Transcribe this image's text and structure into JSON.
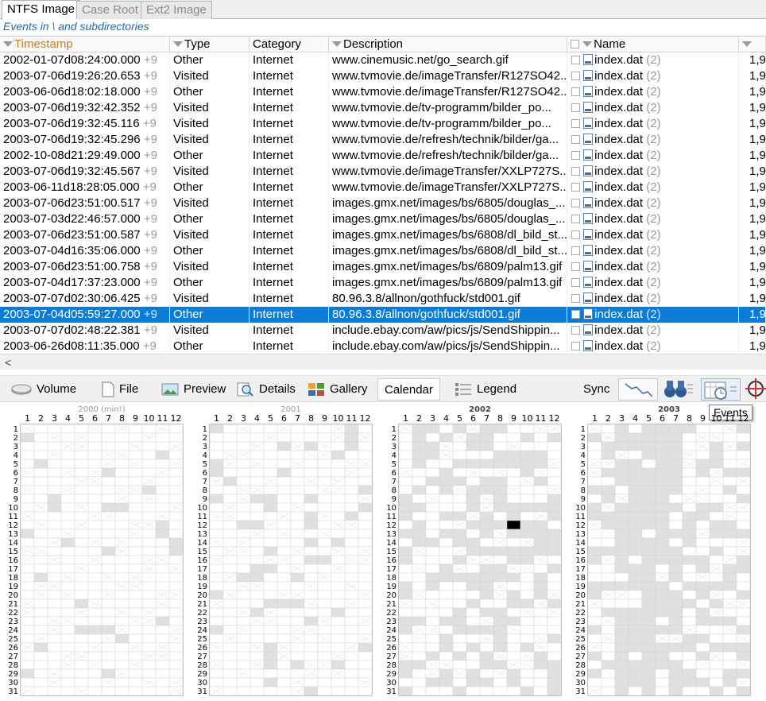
{
  "tabs": [
    {
      "label": "NTFS Image",
      "active": true
    },
    {
      "label": "Case Root",
      "active": false
    },
    {
      "label": "Ext2 Image",
      "active": false
    }
  ],
  "subtitle": "Events in \\ and subdirectories",
  "columns": {
    "timestamp": "Timestamp",
    "type": "Type",
    "category": "Category",
    "description": "Description",
    "name": "Name"
  },
  "rows": [
    {
      "ts": "2002-01-07d08:24:00.000",
      "plus": "+9",
      "type": "Other",
      "cat": "Internet",
      "desc": "www.cinemusic.net/go_search.gif",
      "name": "index.dat",
      "count": "(2)",
      "extra": "1,9"
    },
    {
      "ts": "2003-07-06d19:26:20.653",
      "plus": "+9",
      "type": "Visited",
      "cat": "Internet",
      "desc": "www.tvmovie.de/imageTransfer/R127SO42...",
      "name": "index.dat",
      "count": "(2)",
      "extra": "1,9"
    },
    {
      "ts": "2003-06-06d18:02:18.000",
      "plus": "+9",
      "type": "Other",
      "cat": "Internet",
      "desc": "www.tvmovie.de/imageTransfer/R127SO42...",
      "name": "index.dat",
      "count": "(2)",
      "extra": "1,9"
    },
    {
      "ts": "2003-07-06d19:32:42.352",
      "plus": "+9",
      "type": "Visited",
      "cat": "Internet",
      "desc": "www.tvmovie.de/tv-programm/bilder_po...",
      "name": "index.dat",
      "count": "(2)",
      "extra": "1,9"
    },
    {
      "ts": "2003-07-06d19:32:45.116",
      "plus": "+9",
      "type": "Visited",
      "cat": "Internet",
      "desc": "www.tvmovie.de/tv-programm/bilder_po...",
      "name": "index.dat",
      "count": "(2)",
      "extra": "1,9"
    },
    {
      "ts": "2003-07-06d19:32:45.296",
      "plus": "+9",
      "type": "Visited",
      "cat": "Internet",
      "desc": "www.tvmovie.de/refresh/technik/bilder/ga...",
      "name": "index.dat",
      "count": "(2)",
      "extra": "1,9"
    },
    {
      "ts": "2002-10-08d21:29:49.000",
      "plus": "+9",
      "type": "Other",
      "cat": "Internet",
      "desc": "www.tvmovie.de/refresh/technik/bilder/ga...",
      "name": "index.dat",
      "count": "(2)",
      "extra": "1,9"
    },
    {
      "ts": "2003-07-06d19:32:45.567",
      "plus": "+9",
      "type": "Visited",
      "cat": "Internet",
      "desc": "www.tvmovie.de/imageTransfer/XXLP727S...",
      "name": "index.dat",
      "count": "(2)",
      "extra": "1,9"
    },
    {
      "ts": "2003-06-11d18:28:05.000",
      "plus": "+9",
      "type": "Other",
      "cat": "Internet",
      "desc": "www.tvmovie.de/imageTransfer/XXLP727S...",
      "name": "index.dat",
      "count": "(2)",
      "extra": "1,9"
    },
    {
      "ts": "2003-07-06d23:51:00.517",
      "plus": "+9",
      "type": "Visited",
      "cat": "Internet",
      "desc": "images.gmx.net/images/bs/6805/douglas_...",
      "name": "index.dat",
      "count": "(2)",
      "extra": "1,9"
    },
    {
      "ts": "2003-07-03d22:46:57.000",
      "plus": "+9",
      "type": "Other",
      "cat": "Internet",
      "desc": "images.gmx.net/images/bs/6805/douglas_...",
      "name": "index.dat",
      "count": "(2)",
      "extra": "1,9"
    },
    {
      "ts": "2003-07-06d23:51:00.587",
      "plus": "+9",
      "type": "Visited",
      "cat": "Internet",
      "desc": "images.gmx.net/images/bs/6808/dl_bild_st...",
      "name": "index.dat",
      "count": "(2)",
      "extra": "1,9"
    },
    {
      "ts": "2003-07-04d16:35:06.000",
      "plus": "+9",
      "type": "Other",
      "cat": "Internet",
      "desc": "images.gmx.net/images/bs/6808/dl_bild_st...",
      "name": "index.dat",
      "count": "(2)",
      "extra": "1,9"
    },
    {
      "ts": "2003-07-06d23:51:00.758",
      "plus": "+9",
      "type": "Visited",
      "cat": "Internet",
      "desc": "images.gmx.net/images/bs/6809/palm13.gif",
      "name": "index.dat",
      "count": "(2)",
      "extra": "1,9"
    },
    {
      "ts": "2003-07-04d17:37:23.000",
      "plus": "+9",
      "type": "Other",
      "cat": "Internet",
      "desc": "images.gmx.net/images/bs/6809/palm13.gif",
      "name": "index.dat",
      "count": "(2)",
      "extra": "1,9"
    },
    {
      "ts": "2003-07-07d02:30:06.425",
      "plus": "+9",
      "type": "Visited",
      "cat": "Internet",
      "desc": "80.96.3.8/allnon/gothfuck/std001.gif",
      "name": "index.dat",
      "count": "(2)",
      "extra": "1,9"
    },
    {
      "ts": "2003-07-04d05:59:27.000",
      "plus": "+9",
      "type": "Other",
      "cat": "Internet",
      "desc": "80.96.3.8/allnon/gothfuck/std001.gif",
      "name": "index.dat",
      "count": "(2)",
      "extra": "1,9",
      "selected": true
    },
    {
      "ts": "2003-07-07d02:48:22.381",
      "plus": "+9",
      "type": "Visited",
      "cat": "Internet",
      "desc": "include.ebay.com/aw/pics/js/SendShippin...",
      "name": "index.dat",
      "count": "(2)",
      "extra": "1,9"
    },
    {
      "ts": "2003-06-26d08:11:35.000",
      "plus": "+9",
      "type": "Other",
      "cat": "Internet",
      "desc": "include.ebay.com/aw/pics/js/SendShippin...",
      "name": "index.dat",
      "count": "(2)",
      "extra": "1,9"
    }
  ],
  "scroll_arrow": "<",
  "toolbar": {
    "volume": "Volume",
    "file": "File",
    "preview": "Preview",
    "details": "Details",
    "gallery": "Gallery",
    "calendar": "Calendar",
    "legend": "Legend",
    "sync": "Sync"
  },
  "tooltip": "Events",
  "calendars": [
    {
      "title": "2000 (min!)",
      "bold": false
    },
    {
      "title": "2001",
      "bold": false
    },
    {
      "title": "2002",
      "bold": true
    },
    {
      "title": "2003",
      "bold": true
    }
  ],
  "month_labels": [
    "1",
    "2",
    "3",
    "4",
    "5",
    "6",
    "7",
    "8",
    "9",
    "10",
    "11",
    "12"
  ],
  "day_labels": [
    "1",
    "2",
    "3",
    "4",
    "5",
    "6",
    "7",
    "8",
    "9",
    "10",
    "11",
    "12",
    "13",
    "14",
    "15",
    "16",
    "17",
    "18",
    "19",
    "20",
    "21",
    "22",
    "23",
    "24",
    "25",
    "26",
    "27",
    "28",
    "29",
    "30",
    "31"
  ],
  "colors": {
    "selection": "#0a7bd6",
    "subtitle": "#1a6bb0",
    "timestamp_header": "#c77b2b",
    "activity_cell": "#e0e0e0",
    "selected_day": "#000000"
  }
}
